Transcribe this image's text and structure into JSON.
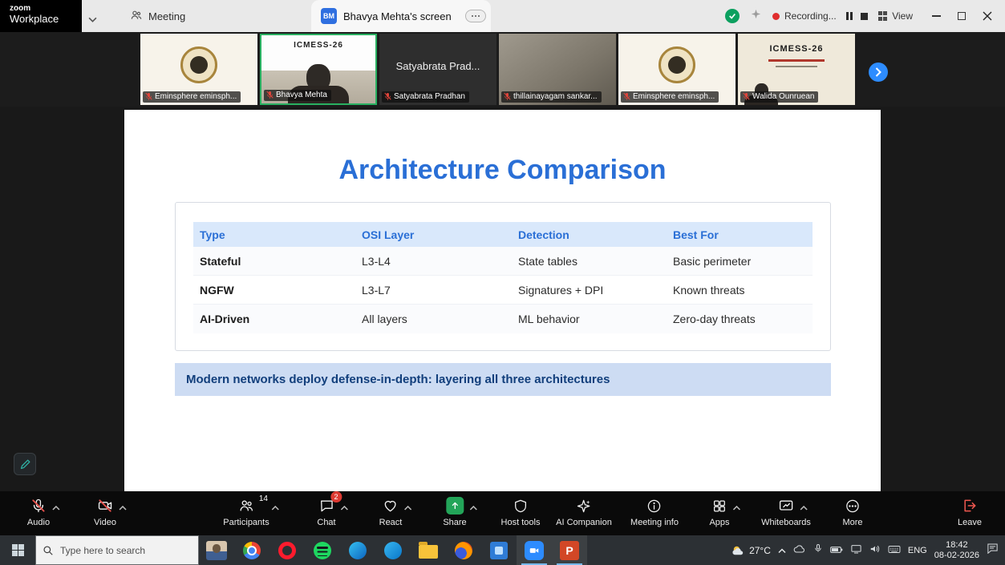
{
  "titlebar": {
    "brand_top": "zoom",
    "brand_bottom": "Workplace",
    "meeting_tab_label": "Meeting",
    "screen_tab_label": "Bhavya Mehta's screen",
    "screen_tab_avatar": "BM",
    "recording_label": "Recording...",
    "view_label": "View"
  },
  "video_strip": {
    "participants": [
      {
        "name": "Eminsphere eminsph...",
        "variant": "logo"
      },
      {
        "name": "Bhavya Mehta",
        "variant": "camera",
        "banner_text": "ICMESS-26",
        "active": true
      },
      {
        "name": "Satyabrata Pradhan",
        "variant": "text",
        "center_text": "Satyabrata  Prad..."
      },
      {
        "name": "thillainayagam sankar...",
        "variant": "photo"
      },
      {
        "name": "Eminsphere eminsph...",
        "variant": "logo"
      },
      {
        "name": "Walida Ounruean",
        "variant": "slide",
        "banner_text": "ICMESS-26"
      }
    ]
  },
  "slide": {
    "title": "Architecture Comparison",
    "table": {
      "headers": [
        "Type",
        "OSI Layer",
        "Detection",
        "Best For"
      ],
      "rows": [
        [
          "Stateful",
          "L3-L4",
          "State tables",
          "Basic perimeter"
        ],
        [
          "NGFW",
          "L3-L7",
          "Signatures + DPI",
          "Known threats"
        ],
        [
          "AI-Driven",
          "All layers",
          "ML behavior",
          "Zero-day threats"
        ]
      ]
    },
    "banner": "Modern networks deploy defense-in-depth: layering all three architectures"
  },
  "toolbar": {
    "audio": "Audio",
    "video": "Video",
    "participants": "Participants",
    "participants_count": "14",
    "chat": "Chat",
    "chat_badge": "2",
    "react": "React",
    "share": "Share",
    "host_tools": "Host tools",
    "ai_companion": "AI Companion",
    "meeting_info": "Meeting info",
    "apps": "Apps",
    "whiteboards": "Whiteboards",
    "more": "More",
    "leave": "Leave"
  },
  "taskbar": {
    "search_placeholder": "Type here to search",
    "app_icons": [
      "presenter-thumbnail",
      "chrome",
      "opera",
      "spotify",
      "edge",
      "skype",
      "file-explorer",
      "firefox",
      "photos",
      "zoom",
      "powerpoint"
    ],
    "powerpoint_glyph": "P",
    "tray_icons": [
      "weather",
      "chevron-up",
      "cloud",
      "mic",
      "battery",
      "network",
      "volume",
      "keyboard",
      "action-center"
    ],
    "temperature": "27°C",
    "language": "ENG",
    "time": "18:42",
    "date": "08-02-2026"
  },
  "colors": {
    "accent_blue": "#2a6fd6",
    "table_header_bg": "#d9e8fb",
    "banner_bg": "#cddcf3",
    "banner_text": "#123f7c",
    "share_green": "#23a559",
    "leave_red": "#f25850",
    "recording_red": "#e02d2d",
    "active_border_green": "#29b061",
    "zoom_blue": "#2d8cff"
  }
}
